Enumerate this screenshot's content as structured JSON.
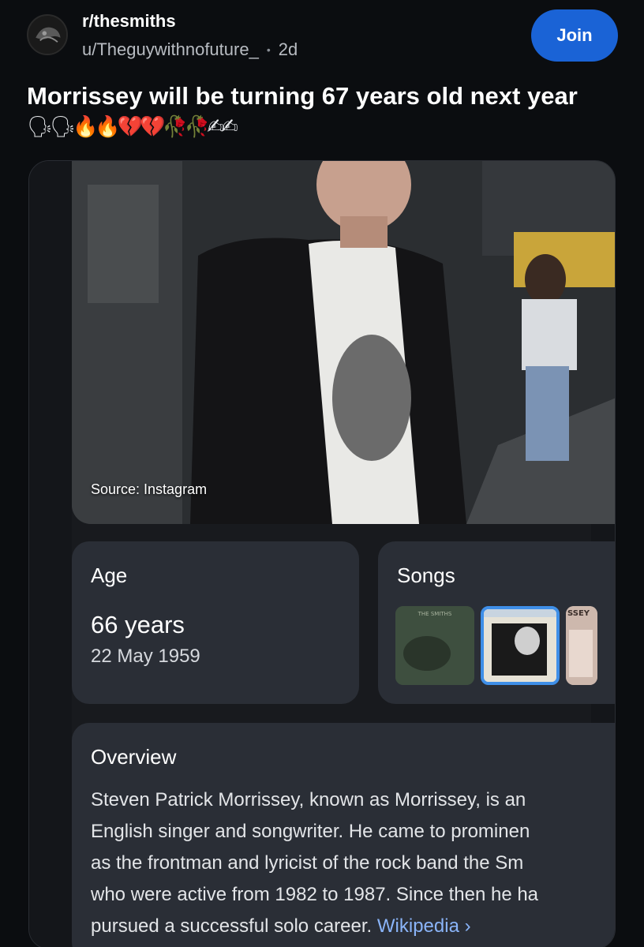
{
  "header": {
    "subreddit": "r/thesmiths",
    "username": "u/Theguywithnofuture_",
    "separator": "•",
    "age": "2d",
    "join_label": "Join"
  },
  "post": {
    "title": "Morrissey will be turning 67 years old next year",
    "emojis": "🗣🗣🔥🔥💔💔🥀🥀✍✍"
  },
  "card": {
    "source_label": "Source: Instagram",
    "age": {
      "label": "Age",
      "value": "66 years",
      "date": "22 May 1959"
    },
    "songs": {
      "label": "Songs",
      "thumb_text": [
        "THE SMITHS",
        "SSEY"
      ]
    },
    "overview": {
      "label": "Overview",
      "lines": [
        "Steven Patrick Morrissey, known as Morrissey, is an",
        "English singer and songwriter. He came to prominen",
        "as the frontman and lyricist of the rock band the Sm",
        "who were active from 1982 to 1987. Since then he ha",
        "pursued a successful solo career."
      ],
      "link": "Wikipedia ›"
    }
  }
}
